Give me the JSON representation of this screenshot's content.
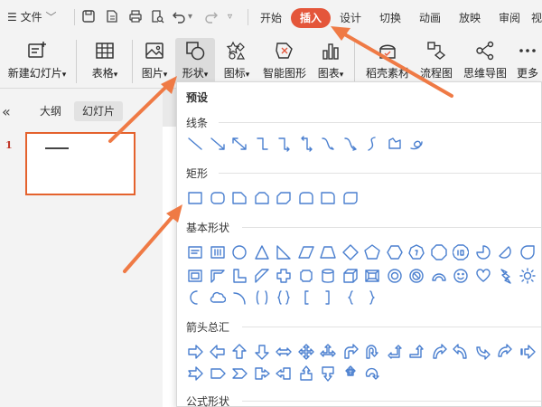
{
  "titlebar": {
    "menu_label": "文件",
    "tabs": [
      "开始",
      "插入",
      "设计",
      "切换",
      "动画",
      "放映",
      "审阅",
      "视"
    ]
  },
  "ribbon": {
    "items": [
      {
        "label": "新建幻灯片",
        "caret": "▾",
        "icon": "new-slide-icon"
      },
      {
        "label": "表格",
        "caret": "▾",
        "icon": "table-icon"
      },
      {
        "label": "图片",
        "caret": "▾",
        "icon": "picture-icon"
      },
      {
        "label": "形状",
        "caret": "▾",
        "icon": "shapes-icon"
      },
      {
        "label": "图标",
        "caret": "▾",
        "icon": "icons-icon"
      },
      {
        "label": "智能图形",
        "caret": "",
        "icon": "smart-graphic-icon"
      },
      {
        "label": "图表",
        "caret": "▾",
        "icon": "chart-icon"
      },
      {
        "label": "稻壳素材",
        "caret": "",
        "icon": "docer-material-icon"
      },
      {
        "label": "流程图",
        "caret": "",
        "icon": "flowchart-icon"
      },
      {
        "label": "思维导图",
        "caret": "",
        "icon": "mindmap-icon"
      },
      {
        "label": "更多",
        "caret": "",
        "icon": "more-icon"
      }
    ]
  },
  "panel": {
    "tabs": [
      "大纲",
      "幻灯片"
    ],
    "slide_number": "1"
  },
  "dropdown": {
    "title": "预设",
    "sections": [
      "线条",
      "矩形",
      "基本形状",
      "箭头总汇",
      "公式形状"
    ]
  },
  "colors": {
    "accent": "#e4563a",
    "shape_stroke": "#4a7fcf",
    "thumb_border": "#e4622d"
  }
}
